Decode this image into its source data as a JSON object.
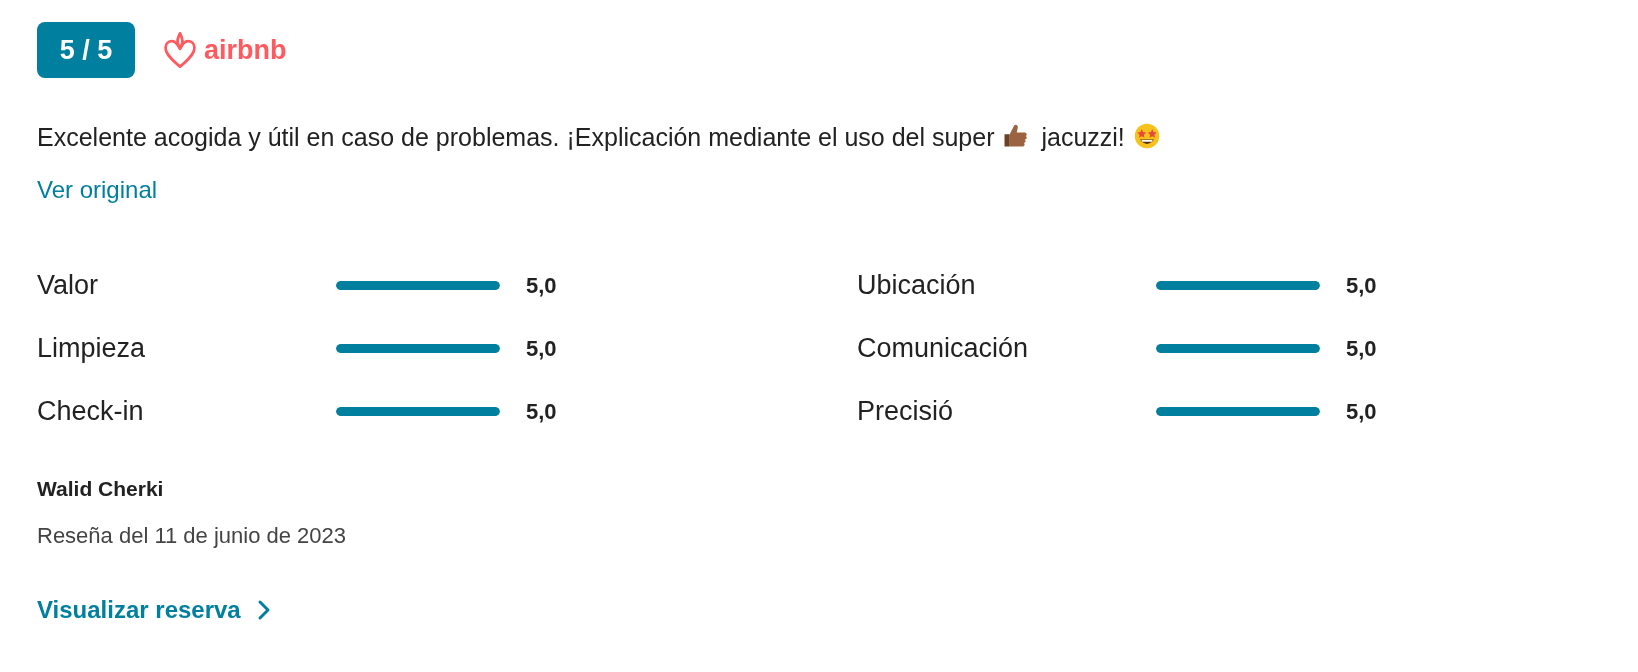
{
  "score": {
    "text": "5 / 5"
  },
  "source": {
    "name": "airbnb"
  },
  "review": {
    "segments": [
      {
        "kind": "text",
        "text": "Excelente acogida y útil en caso de problemas. ¡Explicación mediante el uso del super"
      },
      {
        "kind": "thumbs_up"
      },
      {
        "kind": "text",
        "text": "jacuzzi!"
      },
      {
        "kind": "star_struck"
      }
    ]
  },
  "translation_link": "Ver original",
  "ratings": [
    [
      {
        "label": "Valor",
        "level": 1,
        "reading": "5,0"
      },
      {
        "label": "Limpieza",
        "level": 1,
        "reading": "5,0"
      },
      {
        "label": "Check-in",
        "level": 1,
        "reading": "5,0"
      }
    ],
    [
      {
        "label": "Ubicación",
        "level": 1,
        "reading": "5,0"
      },
      {
        "label": "Comunicación",
        "level": 1,
        "reading": "5,0"
      },
      {
        "label": "Precisió",
        "level": 1,
        "reading": "5,0"
      }
    ]
  ],
  "reviewer": {
    "name": "Walid Cherki",
    "date": "Reseña del 11 de junio de 2023"
  },
  "booking_link": "Visualizar reserva"
}
